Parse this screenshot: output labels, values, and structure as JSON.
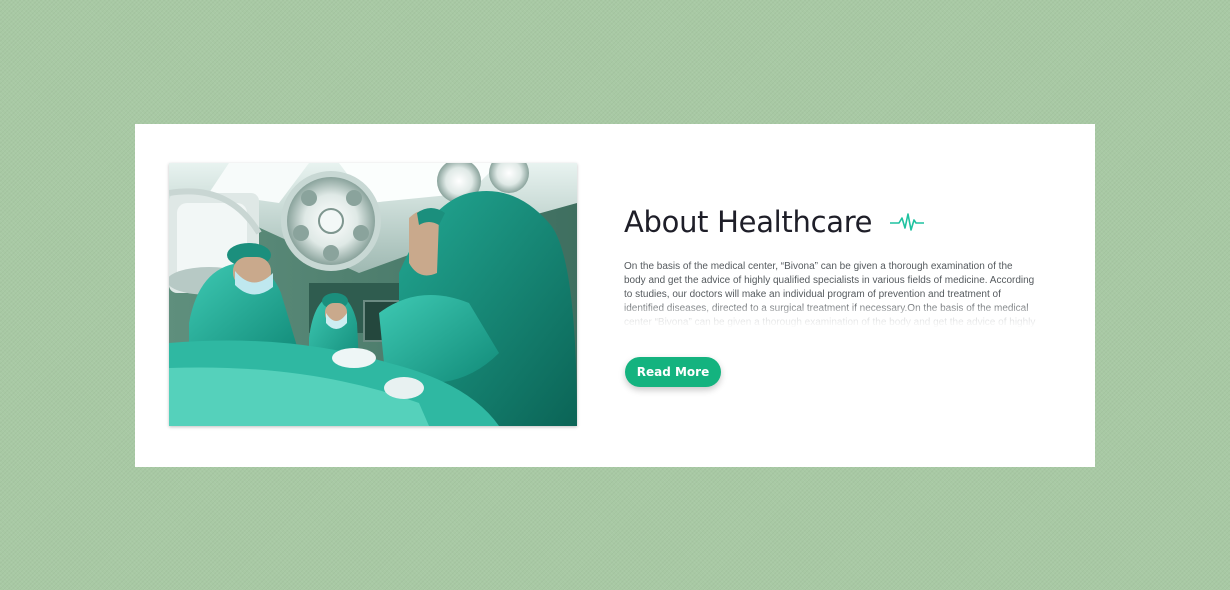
{
  "about": {
    "title": "About Healthcare",
    "description": "On the basis of the medical center, “Bivona” can be given a thorough examination of the body and get the advice of highly qualified specialists in various fields of medicine. According to studies, our doctors will make an individual program of prevention and treatment of identified diseases, directed to a surgical treatment if necessary.On the basis of the medical center “Bivona” can be given a thorough examination of the body and get the advice of highly qualified specialists in various fields of medicine.",
    "read_more_label": "Read More",
    "image_alt": "surgeons-operating-room-photo"
  },
  "colors": {
    "page_background": "#a8c9a4",
    "accent": "#14b37f",
    "pulse_icon": "#1fc2a0",
    "title_text": "#1e1e28",
    "body_text": "#555a5e"
  },
  "icons": {
    "title_decoration": "heartbeat-pulse-icon"
  }
}
